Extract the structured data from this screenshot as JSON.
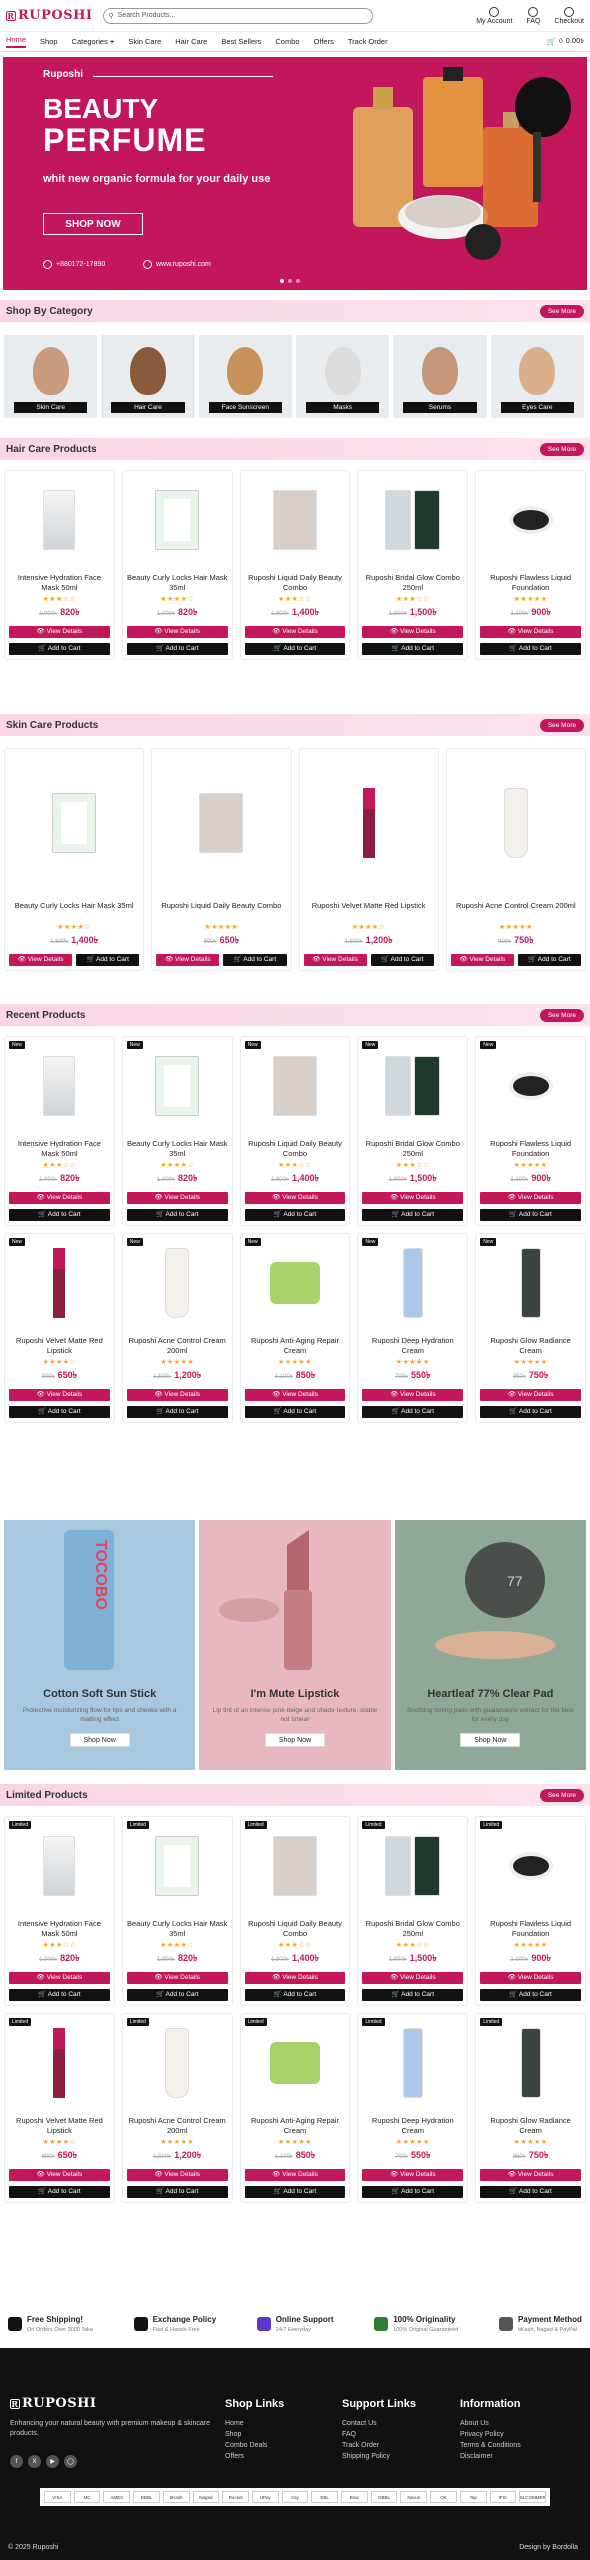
{
  "header": {
    "logo": "RUPOSHI",
    "search_placeholder": "Search Products...",
    "icons": [
      {
        "label": "My Account",
        "icon": "user-icon"
      },
      {
        "label": "FAQ",
        "icon": "question-icon"
      },
      {
        "label": "Checkout",
        "icon": "checkout-icon"
      }
    ]
  },
  "nav": {
    "items": [
      "Home",
      "Shop",
      "Categories",
      "Skin Care",
      "Hair Care",
      "Best Sellers",
      "Combo",
      "Offers",
      "Track Order"
    ],
    "categories_plus": "+",
    "cart_count": "0",
    "cart_total": "0.00৳"
  },
  "hero": {
    "brand": "Ruposhi",
    "title1": "BEAUTY",
    "title2": "PERFUME",
    "subtitle": "whit new organic formula for your daily use",
    "button": "SHOP NOW",
    "phone": "+880172-17890",
    "website": "www.ruposhi.com",
    "colors": {
      "bg": "#c2185b"
    }
  },
  "categories": {
    "title": "Shop By Category",
    "more": "See More",
    "items": [
      "Skin Care",
      "Hair Care",
      "Face Sunscreen",
      "Masks",
      "Serums",
      "Eyes Care"
    ]
  },
  "hair_care": {
    "title": "Hair Care Products",
    "more": "See More",
    "products": [
      {
        "name": "Intensive Hydration Face Mask 50ml",
        "stars": "★★★☆☆",
        "old": "1,000৳",
        "price": "820৳"
      },
      {
        "name": "Beauty Curly Locks Hair Mask 35ml",
        "stars": "★★★★☆",
        "old": "1,000৳",
        "price": "820৳"
      },
      {
        "name": "Ruposhi Liquid Daily Beauty Combo",
        "stars": "★★★☆☆",
        "old": "1,600৳",
        "price": "1,400৳"
      },
      {
        "name": "Ruposhi Bridal Glow Combo 250ml",
        "stars": "★★★☆☆",
        "old": "1,800৳",
        "price": "1,500৳"
      },
      {
        "name": "Ruposhi Flawless Liquid Foundation",
        "stars": "★★★★★",
        "old": "1,100৳",
        "price": "900৳"
      }
    ]
  },
  "skin_care": {
    "title": "Skin Care Products",
    "more": "See More",
    "products": [
      {
        "name": "Beauty Curly Locks Hair Mask 35ml",
        "stars": "★★★★☆",
        "old": "1,600৳",
        "price": "1,400৳"
      },
      {
        "name": "Ruposhi Liquid Daily Beauty Combo",
        "stars": "★★★★★",
        "old": "800৳",
        "price": "650৳"
      },
      {
        "name": "Ruposhi Velvet Matte Red Lipstick",
        "stars": "★★★★☆",
        "old": "1,500৳",
        "price": "1,200৳"
      },
      {
        "name": "Ruposhi Acne Control Cream 200ml",
        "stars": "★★★★★",
        "old": "900৳",
        "price": "750৳"
      }
    ]
  },
  "recent": {
    "title": "Recent Products",
    "more": "See More",
    "tag": "New",
    "products": [
      {
        "name": "Intensive Hydration Face Mask 50ml",
        "stars": "★★★☆☆",
        "old": "1,000৳",
        "price": "820৳"
      },
      {
        "name": "Beauty Curly Locks Hair Mask 35ml",
        "stars": "★★★★☆",
        "old": "1,000৳",
        "price": "820৳"
      },
      {
        "name": "Ruposhi Liquid Daily Beauty Combo",
        "stars": "★★★☆☆",
        "old": "1,600৳",
        "price": "1,400৳"
      },
      {
        "name": "Ruposhi Bridal Glow Combo 250ml",
        "stars": "★★★☆☆",
        "old": "1,800৳",
        "price": "1,500৳"
      },
      {
        "name": "Ruposhi Flawless Liquid Foundation",
        "stars": "★★★★★",
        "old": "1,100৳",
        "price": "900৳"
      },
      {
        "name": "Ruposhi Velvet Matte Red Lipstick",
        "stars": "★★★★☆",
        "old": "800৳",
        "price": "650৳"
      },
      {
        "name": "Ruposhi Acne Control Cream 200ml",
        "stars": "★★★★★",
        "old": "1,500৳",
        "price": "1,200৳"
      },
      {
        "name": "Ruposhi Anti-Aging Repair Cream",
        "stars": "★★★★★",
        "old": "1,100৳",
        "price": "850৳"
      },
      {
        "name": "Ruposhi Deep Hydration Cream",
        "stars": "★★★★★",
        "old": "700৳",
        "price": "550৳"
      },
      {
        "name": "Ruposhi Glow Radiance Cream",
        "stars": "★★★★★",
        "old": "950৳",
        "price": "750৳"
      }
    ]
  },
  "banners": [
    {
      "title": "Cotton Soft Sun Stick",
      "text": "Protective moisturizing flow for lips and cheeks with a matting effect",
      "button": "Shop Now",
      "product_text": "TOCOBO"
    },
    {
      "title": "I'm Mute Lipstick",
      "text": "Lip tint of an intense pink-beige and shade texture, stable not smear",
      "button": "Shop Now"
    },
    {
      "title": "Heartleaf 77% Clear Pad",
      "text": "Soothing toning pads with guaiazulene extract for the face for every day",
      "button": "Shop Now",
      "product_text": "77"
    }
  ],
  "limited": {
    "title": "Limited Products",
    "more": "See More",
    "tag": "Limited",
    "products": [
      {
        "name": "Intensive Hydration Face Mask 50ml",
        "stars": "★★★☆☆",
        "old": "1,000৳",
        "price": "820৳"
      },
      {
        "name": "Beauty Curly Locks Hair Mask 35ml",
        "stars": "★★★★☆",
        "old": "1,000৳",
        "price": "820৳"
      },
      {
        "name": "Ruposhi Liquid Daily Beauty Combo",
        "stars": "★★★☆☆",
        "old": "1,600৳",
        "price": "1,400৳"
      },
      {
        "name": "Ruposhi Bridal Glow Combo 250ml",
        "stars": "★★★☆☆",
        "old": "1,800৳",
        "price": "1,500৳"
      },
      {
        "name": "Ruposhi Flawless Liquid Foundation",
        "stars": "★★★★★",
        "old": "1,100৳",
        "price": "900৳"
      },
      {
        "name": "Ruposhi Velvet Matte Red Lipstick",
        "stars": "★★★★☆",
        "old": "800৳",
        "price": "650৳"
      },
      {
        "name": "Ruposhi Acne Control Cream 200ml",
        "stars": "★★★★★",
        "old": "1,500৳",
        "price": "1,200৳"
      },
      {
        "name": "Ruposhi Anti-Aging Repair Cream",
        "stars": "★★★★★",
        "old": "1,100৳",
        "price": "850৳"
      },
      {
        "name": "Ruposhi Deep Hydration Cream",
        "stars": "★★★★★",
        "old": "700৳",
        "price": "550৳"
      },
      {
        "name": "Ruposhi Glow Radiance Cream",
        "stars": "★★★★★",
        "old": "950৳",
        "price": "750৳"
      }
    ]
  },
  "buttons": {
    "view": "👁 View Details",
    "cart": "🛒 Add to Cart"
  },
  "features": [
    {
      "title": "Free Shipping!",
      "sub": "On Orders Over 3000 Taka",
      "color": "#111111"
    },
    {
      "title": "Exchange Policy",
      "sub": "Fast & Hassle Free",
      "color": "#111111"
    },
    {
      "title": "Online Support",
      "sub": "24/7 Everyday",
      "color": "#5c35c9"
    },
    {
      "title": "100% Originality",
      "sub": "100% Original Guaranteed",
      "color": "#2e7d32"
    },
    {
      "title": "Payment Method",
      "sub": "bKash, Nagad & PayPal",
      "color": "#555555"
    }
  ],
  "footer": {
    "logo": "RUPOSHI",
    "tagline": "Enhancing your natural beauty with premium makeup & skincare products.",
    "cols": [
      {
        "title": "Shop Links",
        "links": [
          "Home",
          "Shop",
          "Combo Deals",
          "Offers"
        ]
      },
      {
        "title": "Support Links",
        "links": [
          "Contact Us",
          "FAQ",
          "Track Order",
          "Shipping Policy"
        ]
      },
      {
        "title": "Information",
        "links": [
          "About Us",
          "Privacy Policy",
          "Terms & Conditions",
          "Disclaimer"
        ]
      }
    ],
    "payments": [
      "VISA",
      "MC",
      "AMEX",
      "DBBL",
      "bKash",
      "Nagad",
      "Rocket",
      "UPay",
      "City",
      "EBL",
      "Brac",
      "DBBL",
      "Nexus",
      "OK",
      "Tap",
      "IFIC",
      "SSLCOMMERZ"
    ],
    "copyright": "© 2025 Ruposhi",
    "design": "Design by Bordolla"
  }
}
